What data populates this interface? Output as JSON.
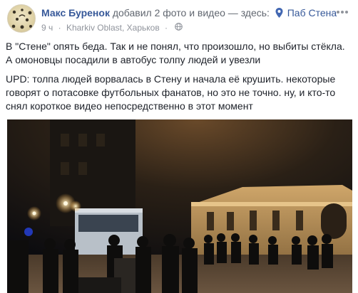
{
  "post": {
    "author": "Макс Буренок",
    "action": "добавил 2 фото и видео — здесь:",
    "place": "Паб Стена",
    "time": "9 ч",
    "location": "Kharkiv Oblast, Харьков",
    "paragraph1": "В \"Стене\" опять беда. Так и не понял, что произошло, но выбиты стёкла. А омоновцы посадили в автобус толпу людей и увезли",
    "paragraph2": "UPD: толпа людей ворвалась в Стену и начала её крушить. некоторые говорят о потасовке футбольных фанатов, но это не точно. ну, и кто-то снял короткое видео непосредственно в этот момент",
    "separator": "·"
  },
  "icons": {
    "avatar": "avatar-image",
    "location": "location-pin-icon",
    "privacy": "globe-icon",
    "menu": "more-options-icon"
  },
  "colors": {
    "link": "#365899",
    "meta": "#90949c",
    "text": "#1d2129"
  }
}
